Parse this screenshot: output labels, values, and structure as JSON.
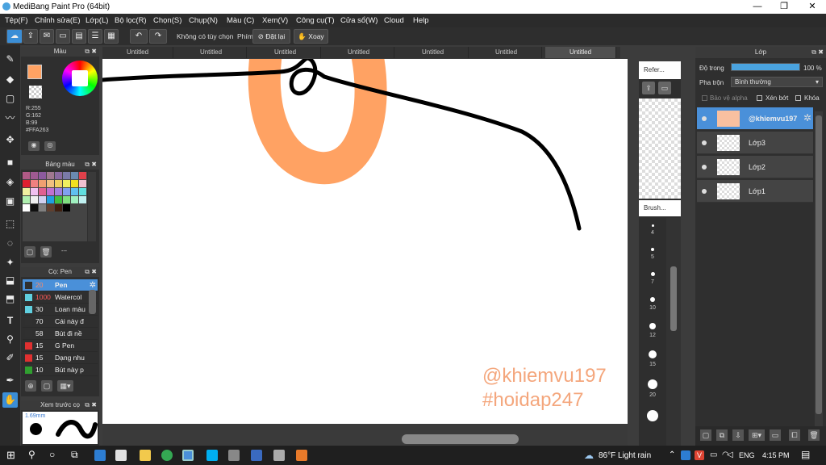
{
  "window": {
    "title": "MediBang Paint Pro (64bit)",
    "minimize": "—",
    "maximize": "❐",
    "close": "✕"
  },
  "menu": [
    "Tệp(F)",
    "Chỉnh sửa(E)",
    "Lớp(L)",
    "Bộ lọc(R)",
    "Chọn(S)",
    "Chụp(N)",
    "Màu (C)",
    "Xem(V)",
    "Công cụ(T)",
    "Cửa sổ(W)",
    "Cloud",
    "Help"
  ],
  "toolbar": {
    "no_option": "Không có tùy chọn",
    "phim_label": "Phím",
    "reset_label": "Đặt lại",
    "rotate_label": "Xoay"
  },
  "tabs": [
    "Untitled",
    "Untitled",
    "Untitled",
    "Untitled",
    "Untitled",
    "Untitled",
    "Untitled"
  ],
  "color_panel": {
    "title": "Màu",
    "r": "R:255",
    "g": "G:162",
    "b": "B:99",
    "hex": "#FFA263",
    "foreground": "#FFA263",
    "background": "#FFFFFF"
  },
  "palette_panel": {
    "title": "Bảng màu",
    "extra": "---",
    "swatches": [
      "#b05a86",
      "#9e5a92",
      "#8c5a9e",
      "#a07890",
      "#8a6aa0",
      "#7a7aa8",
      "#6a8ab0",
      "#e0404a",
      "#e02030",
      "#f08080",
      "#f0a070",
      "#f0c080",
      "#f0d060",
      "#f0f060",
      "#f0e020",
      "#f0c0d0",
      "#f0f0a0",
      "#f0c0f0",
      "#e06090",
      "#c070d0",
      "#a080e0",
      "#80a0f0",
      "#60c0f0",
      "#60e0e0",
      "#b0f0b0",
      "#f0f0f0",
      "#d0d0f0",
      "#20a0e0",
      "#40c040",
      "#80e080",
      "#a0f0c0",
      "#c0f0f0",
      "#ffffff",
      "#101010",
      "#808080",
      "#604030",
      "#402010",
      "#000000"
    ]
  },
  "brush_panel": {
    "title": "Cọ: Pen",
    "brushes": [
      {
        "size": "20",
        "name": "Pen",
        "color": "#303030"
      },
      {
        "size": "1000",
        "name": "Watercol",
        "color": "#60d0e0"
      },
      {
        "size": "30",
        "name": "Loan màu",
        "color": "#60d0e0"
      },
      {
        "size": "70",
        "name": "Cái này đ",
        "color": "#303030"
      },
      {
        "size": "58",
        "name": "Bút đi nề",
        "color": "#303030"
      },
      {
        "size": "15",
        "name": "G Pen",
        "color": "#e03030"
      },
      {
        "size": "15",
        "name": "Dạng nhu",
        "color": "#e03030"
      },
      {
        "size": "10",
        "name": "Bút này p",
        "color": "#30a030"
      }
    ]
  },
  "preview_panel": {
    "title": "Xem trước cọ",
    "size": "1.69mm"
  },
  "canvas": {
    "watermark1": "@khiemvu197",
    "watermark2": "#hoidap247"
  },
  "ref_panel": {
    "title": "Refer...",
    "brush_title": "Brush...",
    "sizes": [
      "4",
      "5",
      "7",
      "10",
      "12",
      "15",
      "20"
    ]
  },
  "layer_panel": {
    "title": "Lớp",
    "opacity_label": "Độ trong",
    "opacity_value": "100 %",
    "opacity": 100,
    "blend_label": "Pha trộn",
    "blend_value": "Bình thường",
    "protect_alpha": "Bảo vệ alpha",
    "clipping": "Xén bớt",
    "lock": "Khóa",
    "layers": [
      "@khiemvu197",
      "Lớp3",
      "Lớp2",
      "Lớp1"
    ]
  },
  "taskbar": {
    "weather": "86°F  Light rain",
    "lang": "ENG",
    "time": "4:15 PM"
  }
}
